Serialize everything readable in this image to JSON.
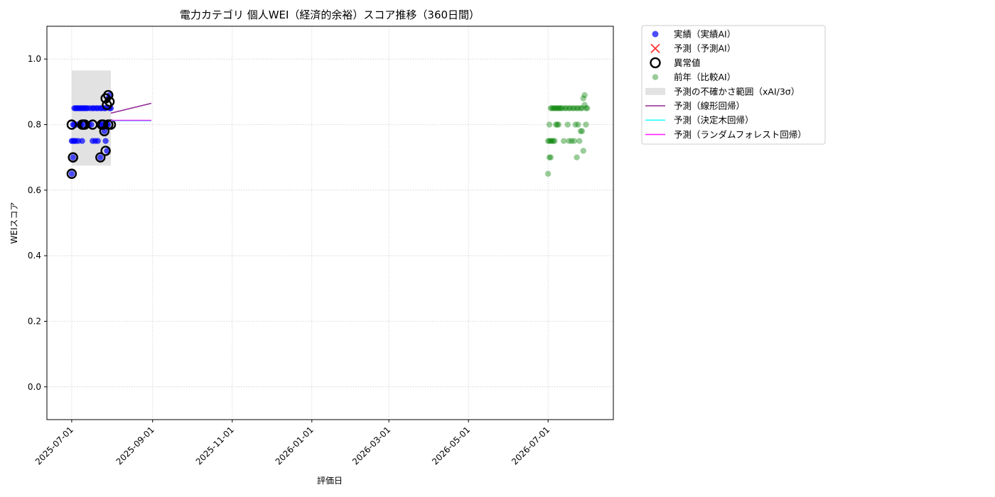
{
  "chart_data": {
    "type": "scatter",
    "title": "電力カテゴリ 個人WEI（経済的余裕）スコア推移（360日間）",
    "xlabel": "評価日",
    "ylabel": "WEIスコア",
    "xlim": [
      "2025-06-12",
      "2026-08-20"
    ],
    "ylim": [
      -0.1,
      1.1
    ],
    "x_ticks": [
      "2025-07-01",
      "2025-09-01",
      "2025-11-01",
      "2026-01-01",
      "2026-03-01",
      "2026-05-01",
      "2026-07-01"
    ],
    "y_ticks": [
      "0.0",
      "0.2",
      "0.4",
      "0.6",
      "0.8",
      "1.0"
    ],
    "grid": true,
    "legend_position": "outside right, top",
    "legend": [
      {
        "key": "actual",
        "label": "実績（実績AI）"
      },
      {
        "key": "forecast",
        "label": "予測（予測AI）"
      },
      {
        "key": "anomaly",
        "label": "異常値"
      },
      {
        "key": "prev_year",
        "label": "前年（比較AI）"
      },
      {
        "key": "band",
        "label": "予測の不確かさ範囲（xAI/3σ）"
      },
      {
        "key": "linear",
        "label": "予測（線形回帰）"
      },
      {
        "key": "tree",
        "label": "予測（決定木回帰）"
      },
      {
        "key": "rf",
        "label": "予測（ランダムフォレスト回帰）"
      }
    ],
    "colors": {
      "actual": "#0000ff",
      "forecast": "#ff0000",
      "anomaly": "#000000",
      "prev_year": "#008000",
      "band": "#d3d3d3",
      "linear": "#800080",
      "tree": "#00ffff",
      "rf": "#ff00ff"
    },
    "series": [
      {
        "key": "actual",
        "x": [
          "2025-07-01",
          "2025-07-01",
          "2025-07-02",
          "2025-07-02",
          "2025-07-02",
          "2025-07-03",
          "2025-07-03",
          "2025-07-03",
          "2025-07-04",
          "2025-07-04",
          "2025-07-05",
          "2025-07-05",
          "2025-07-06",
          "2025-07-06",
          "2025-07-07",
          "2025-07-07",
          "2025-07-08",
          "2025-07-08",
          "2025-07-09",
          "2025-07-09",
          "2025-07-10",
          "2025-07-10",
          "2025-07-11",
          "2025-07-12",
          "2025-07-13",
          "2025-07-14",
          "2025-07-15",
          "2025-07-16",
          "2025-07-17",
          "2025-07-17",
          "2025-07-18",
          "2025-07-19",
          "2025-07-20",
          "2025-07-21",
          "2025-07-21",
          "2025-07-22",
          "2025-07-23",
          "2025-07-23",
          "2025-07-24",
          "2025-07-24",
          "2025-07-25",
          "2025-07-26",
          "2025-07-26",
          "2025-07-27",
          "2025-07-27",
          "2025-07-28",
          "2025-07-28",
          "2025-07-29",
          "2025-07-29",
          "2025-07-30",
          "2025-07-30",
          "2025-07-31"
        ],
        "y": [
          0.65,
          0.75,
          0.8,
          0.7,
          0.75,
          0.85,
          0.8,
          0.75,
          0.85,
          0.75,
          0.85,
          0.8,
          0.85,
          0.75,
          0.85,
          0.8,
          0.85,
          0.8,
          0.85,
          0.75,
          0.85,
          0.8,
          0.85,
          0.85,
          0.85,
          0.8,
          0.85,
          0.8,
          0.85,
          0.75,
          0.85,
          0.75,
          0.85,
          0.75,
          0.85,
          0.8,
          0.85,
          0.7,
          0.85,
          0.8,
          0.8,
          0.85,
          0.78,
          0.75,
          0.85,
          0.72,
          0.8,
          0.8,
          0.88,
          0.85,
          0.89,
          0.85
        ]
      },
      {
        "key": "anomaly",
        "x": [
          "2025-07-01",
          "2025-07-01",
          "2025-07-02",
          "2025-07-02",
          "2025-07-09",
          "2025-07-10",
          "2025-07-11",
          "2025-07-17",
          "2025-07-23",
          "2025-07-24",
          "2025-07-25",
          "2025-07-26",
          "2025-07-27",
          "2025-07-27",
          "2025-07-28",
          "2025-07-29",
          "2025-07-29",
          "2025-07-30",
          "2025-07-31"
        ],
        "y": [
          0.65,
          0.8,
          0.7,
          0.7,
          0.8,
          0.8,
          0.8,
          0.8,
          0.7,
          0.8,
          0.8,
          0.78,
          0.72,
          0.88,
          0.86,
          0.89,
          0.8,
          0.87,
          0.8
        ]
      },
      {
        "key": "prev_year",
        "x": [
          "2026-07-01",
          "2026-07-01",
          "2026-07-02",
          "2026-07-02",
          "2026-07-02",
          "2026-07-03",
          "2026-07-03",
          "2026-07-03",
          "2026-07-04",
          "2026-07-04",
          "2026-07-05",
          "2026-07-05",
          "2026-07-06",
          "2026-07-06",
          "2026-07-07",
          "2026-07-07",
          "2026-07-08",
          "2026-07-08",
          "2026-07-09",
          "2026-07-09",
          "2026-07-10",
          "2026-07-11",
          "2026-07-12",
          "2026-07-13",
          "2026-07-14",
          "2026-07-15",
          "2026-07-16",
          "2026-07-17",
          "2026-07-17",
          "2026-07-18",
          "2026-07-19",
          "2026-07-20",
          "2026-07-21",
          "2026-07-21",
          "2026-07-22",
          "2026-07-23",
          "2026-07-23",
          "2026-07-24",
          "2026-07-24",
          "2026-07-25",
          "2026-07-26",
          "2026-07-26",
          "2026-07-27",
          "2026-07-27",
          "2026-07-28",
          "2026-07-28",
          "2026-07-29",
          "2026-07-29",
          "2026-07-30",
          "2026-07-30",
          "2026-07-31"
        ],
        "y": [
          0.65,
          0.75,
          0.8,
          0.7,
          0.75,
          0.85,
          0.75,
          0.7,
          0.85,
          0.75,
          0.85,
          0.75,
          0.85,
          0.75,
          0.85,
          0.8,
          0.85,
          0.8,
          0.85,
          0.8,
          0.85,
          0.85,
          0.85,
          0.75,
          0.85,
          0.85,
          0.8,
          0.85,
          0.75,
          0.85,
          0.75,
          0.85,
          0.75,
          0.85,
          0.8,
          0.85,
          0.7,
          0.85,
          0.8,
          0.75,
          0.85,
          0.78,
          0.78,
          0.85,
          0.72,
          0.88,
          0.86,
          0.89,
          0.85,
          0.8,
          0.85
        ]
      },
      {
        "key": "band",
        "x": [
          "2025-07-01",
          "2025-07-31"
        ],
        "y_low": 0.675,
        "y_high": 0.965
      },
      {
        "key": "linear",
        "x": [
          "2025-07-31",
          "2025-08-31"
        ],
        "y": [
          0.835,
          0.865
        ]
      },
      {
        "key": "tree",
        "x": [
          "2025-07-31",
          "2025-08-31"
        ],
        "y": [
          0.812,
          0.812
        ]
      },
      {
        "key": "rf",
        "x": [
          "2025-07-31",
          "2025-08-31"
        ],
        "y": [
          0.813,
          0.813
        ]
      }
    ]
  }
}
